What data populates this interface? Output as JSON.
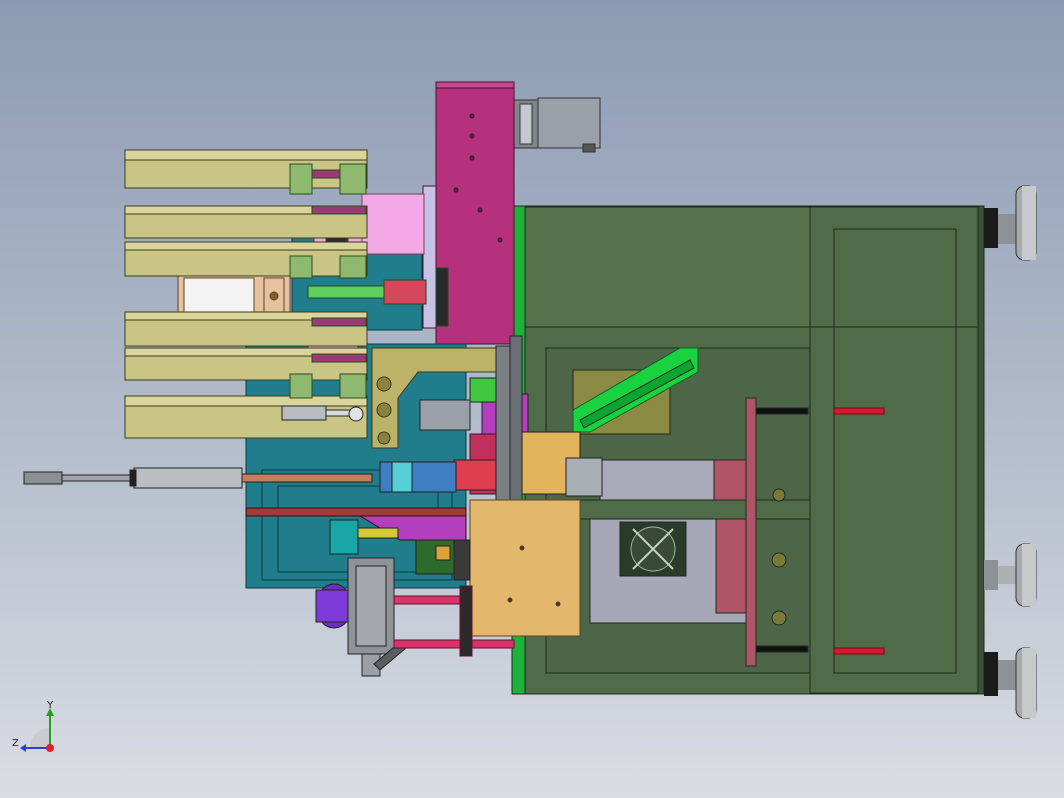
{
  "viewport": {
    "background_top": "#8c9bb3",
    "background_bottom": "#d9dde3"
  },
  "colors": {
    "frame_green": "#4f6b47",
    "frame_dark": "#1f2a1d",
    "magenta": "#b5307d",
    "olive": "#c9c585",
    "teal": "#1f7d8c",
    "bright_green": "#13d43b",
    "tan": "#e3b86c",
    "red_rod": "#d8182e",
    "motor_grey": "#9aa0a8",
    "purple": "#6a2fc2"
  },
  "triad": {
    "y_label": "Y",
    "z_label": "Z"
  }
}
